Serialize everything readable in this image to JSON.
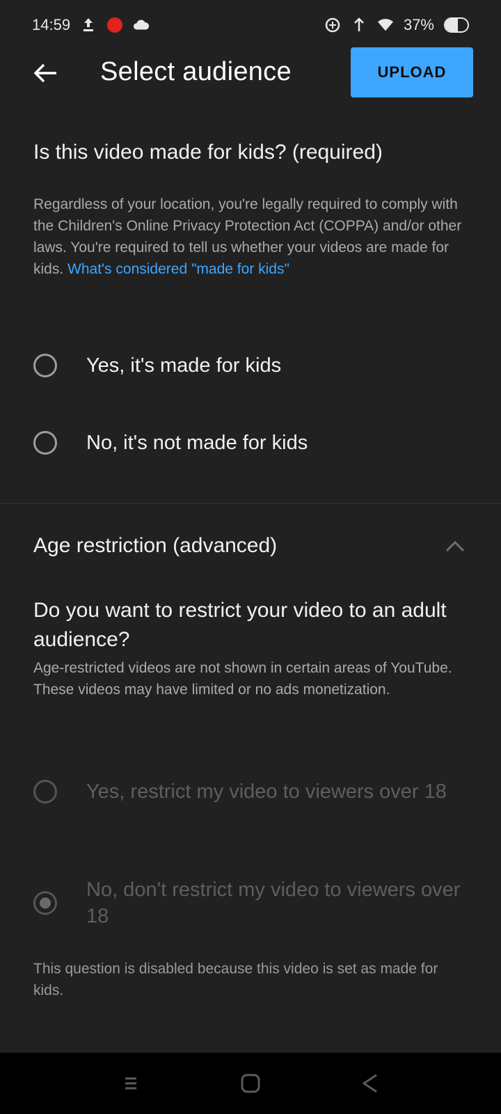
{
  "status_bar": {
    "time": "14:59",
    "battery_text": "37%"
  },
  "app_bar": {
    "title": "Select audience",
    "upload_label": "UPLOAD"
  },
  "kids_section": {
    "heading": "Is this video made for kids? (required)",
    "description": "Regardless of your location, you're legally required to comply with the Children's Online Privacy Protection Act (COPPA) and/or other laws. You're required to tell us whether your videos are made for kids.",
    "link_text": "What's considered \"made for kids\"",
    "options": [
      {
        "label": "Yes, it's made for kids"
      },
      {
        "label": "No, it's not made for kids"
      }
    ]
  },
  "age_section": {
    "header": "Age restriction (advanced)",
    "question": "Do you want to restrict your video to an adult audience?",
    "description": "Age-restricted videos are not shown in certain areas of YouTube. These videos may have limited or no ads monetization.",
    "options": [
      {
        "label": "Yes, restrict my video to viewers over 18"
      },
      {
        "label": "No, don't restrict my video to viewers over 18"
      }
    ],
    "disabled_note": "This question is disabled because this video is set as made for kids."
  },
  "colors": {
    "background": "#212121",
    "accent": "#3ea6ff",
    "navbar": "#000000",
    "recording": "#e0241b"
  }
}
